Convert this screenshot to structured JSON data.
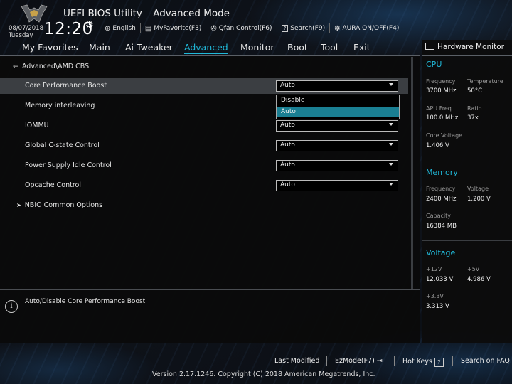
{
  "header": {
    "title": "UEFI BIOS Utility – Advanced Mode",
    "date": "08/07/2018",
    "day": "Tuesday",
    "time": "12:20",
    "items": [
      {
        "label": "English",
        "icon": "globe-icon"
      },
      {
        "label": "MyFavorite(F3)",
        "icon": "favorite-icon"
      },
      {
        "label": "Qfan Control(F6)",
        "icon": "fan-icon"
      },
      {
        "label": "Search(F9)",
        "icon": "search-icon"
      },
      {
        "label": "AURA ON/OFF(F4)",
        "icon": "aura-icon"
      }
    ]
  },
  "tabs": [
    "My Favorites",
    "Main",
    "Ai Tweaker",
    "Advanced",
    "Monitor",
    "Boot",
    "Tool",
    "Exit"
  ],
  "active_tab": "Advanced",
  "breadcrumb": "Advanced\\AMD CBS",
  "settings": [
    {
      "label": "Core Performance Boost",
      "value": "Auto"
    },
    {
      "label": "Memory interleaving",
      "value": "Auto"
    },
    {
      "label": "IOMMU",
      "value": "Auto"
    },
    {
      "label": "Global C-state Control",
      "value": "Auto"
    },
    {
      "label": "Power Supply Idle Control",
      "value": "Auto"
    },
    {
      "label": "Opcache Control",
      "value": "Auto"
    }
  ],
  "dropdown": {
    "options": [
      "Disable",
      "Auto"
    ],
    "highlighted": "Auto"
  },
  "submenu": "NBIO Common Options",
  "help_text": "Auto/Disable Core Performance Boost",
  "hw_monitor": {
    "title": "Hardware Monitor",
    "cpu": {
      "title": "CPU",
      "frequency_label": "Frequency",
      "frequency": "3700 MHz",
      "temperature_label": "Temperature",
      "temperature": "50°C",
      "apu_freq_label": "APU Freq",
      "apu_freq": "100.0 MHz",
      "ratio_label": "Ratio",
      "ratio": "37x",
      "core_voltage_label": "Core Voltage",
      "core_voltage": "1.406 V"
    },
    "memory": {
      "title": "Memory",
      "frequency_label": "Frequency",
      "frequency": "2400 MHz",
      "voltage_label": "Voltage",
      "voltage": "1.200 V",
      "capacity_label": "Capacity",
      "capacity": "16384 MB"
    },
    "voltage": {
      "title": "Voltage",
      "v12_label": "+12V",
      "v12": "12.033 V",
      "v5_label": "+5V",
      "v5": "4.986 V",
      "v33_label": "+3.3V",
      "v33": "3.313 V"
    }
  },
  "footer": {
    "last_modified": "Last Modified",
    "ezmode": "EzMode(F7)",
    "hot_keys": "Hot Keys",
    "hot_keys_key": "?",
    "search_faq": "Search on FAQ",
    "copyright": "Version 2.17.1246. Copyright (C) 2018 American Megatrends, Inc."
  },
  "colors": {
    "accent": "#20b8d8",
    "highlight": "#1a7f93",
    "selected_row": "#3b3e42"
  }
}
